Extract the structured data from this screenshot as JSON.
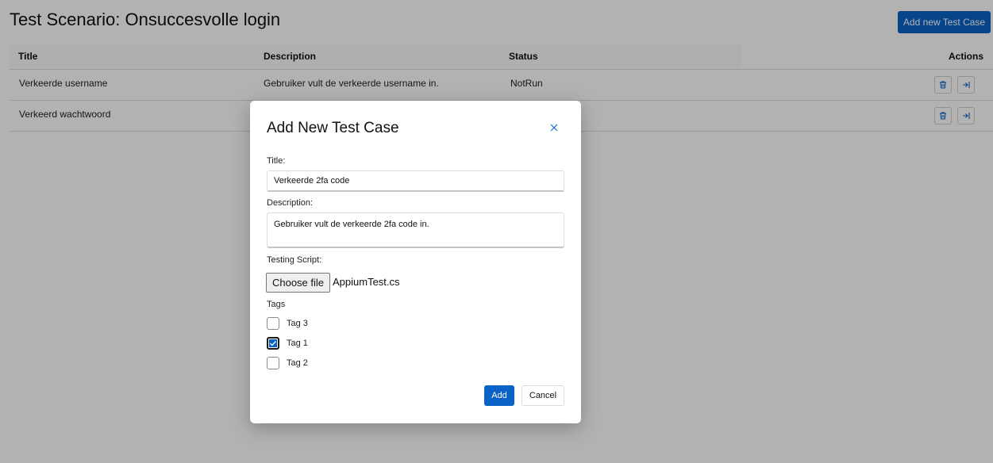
{
  "header": {
    "title": "Test Scenario: Onsuccesvolle login",
    "add_button_label": "Add new Test Case"
  },
  "table": {
    "columns": [
      "Title",
      "Description",
      "Status",
      "Actions"
    ],
    "rows": [
      {
        "title": "Verkeerde username",
        "description": "Gebruiker vult de verkeerde username in.",
        "status": "NotRun"
      },
      {
        "title": "Verkeerd wachtwoord",
        "description": "",
        "status": ""
      }
    ]
  },
  "modal": {
    "title": "Add New Test Case",
    "title_label": "Title:",
    "title_value": "Verkeerde 2fa code",
    "description_label": "Description:",
    "description_value": "Gebruiker vult de verkeerde 2fa code in.",
    "script_label": "Testing Script:",
    "file_button_label": "Choose file",
    "file_name": "AppiumTest.cs",
    "tags_label": "Tags",
    "tags": [
      {
        "label": "Tag 3",
        "checked": false
      },
      {
        "label": "Tag 1",
        "checked": true
      },
      {
        "label": "Tag 2",
        "checked": false
      }
    ],
    "add_label": "Add",
    "cancel_label": "Cancel"
  },
  "colors": {
    "primary": "#0b63c8",
    "overlay": "rgba(0,0,0,0.30)"
  },
  "icons": {
    "row_actions": [
      "trash-icon",
      "enter-icon"
    ],
    "modal_close": "close-icon"
  }
}
